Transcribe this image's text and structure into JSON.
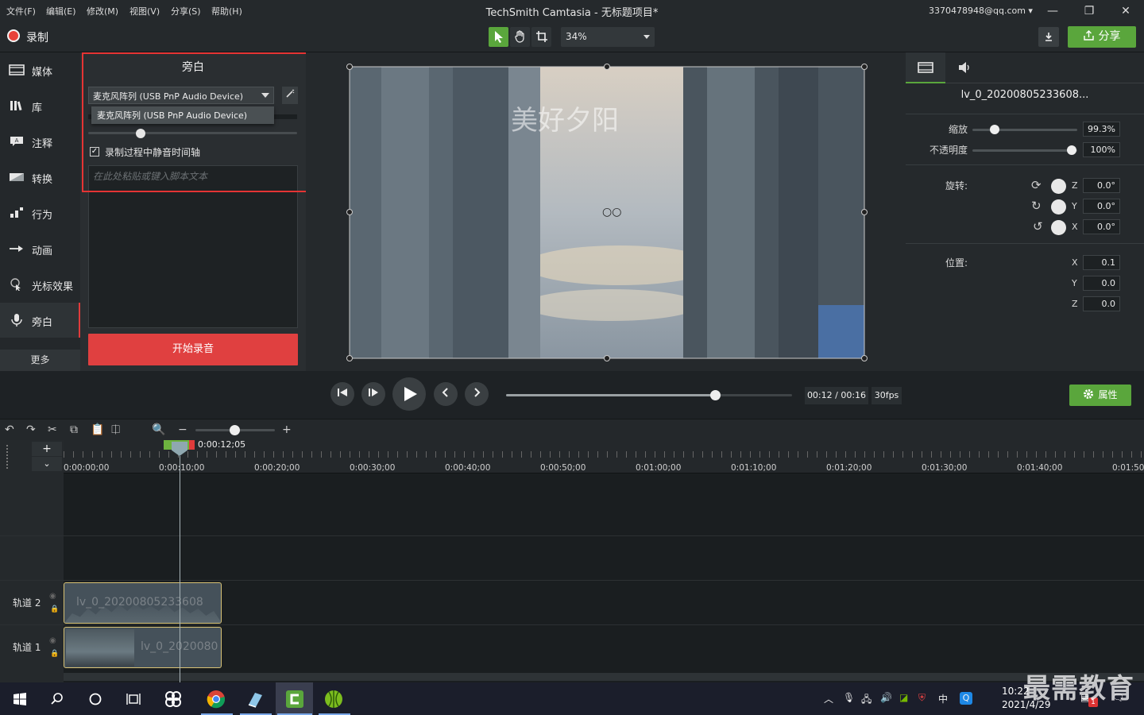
{
  "menu": [
    "文件(F)",
    "编辑(E)",
    "修改(M)",
    "视图(V)",
    "分享(S)",
    "帮助(H)"
  ],
  "app_title": "TechSmith Camtasia - 无标题项目*",
  "account": "3370478948@qq.com ▾",
  "window_controls": {
    "minimize": "—",
    "restore": "❐",
    "close": "✕"
  },
  "toolbar": {
    "record_label": "录制",
    "zoom": "34%",
    "share_label": "分享"
  },
  "sidebar": {
    "items": [
      {
        "label": "媒体",
        "icon": "film-icon"
      },
      {
        "label": "库",
        "icon": "library-icon"
      },
      {
        "label": "注释",
        "icon": "annotation-icon"
      },
      {
        "label": "转换",
        "icon": "transition-icon"
      },
      {
        "label": "行为",
        "icon": "behavior-icon"
      },
      {
        "label": "动画",
        "icon": "animation-icon"
      },
      {
        "label": "光标效果",
        "icon": "cursor-icon"
      },
      {
        "label": "旁白",
        "icon": "microphone-icon"
      }
    ],
    "more_label": "更多"
  },
  "voice_panel": {
    "title": "旁白",
    "mic_selected": "麦克风阵列 (USB PnP Audio Device)",
    "mic_option": "麦克风阵列 (USB PnP Audio Device)",
    "volume_level": 0.25,
    "mute_label": "录制过程中静音时间轴",
    "mute_checked": "✓",
    "script_placeholder": "在此处粘贴或键入脚本文本",
    "start_label": "开始录音"
  },
  "canvas": {
    "caption": "美好夕阳",
    "center_mark": "○○"
  },
  "properties": {
    "clip_name": "lv_0_20200805233608...",
    "scale_label": "缩放",
    "scale_value": "99.3%",
    "opacity_label": "不透明度",
    "opacity_value": "100%",
    "rotation_label": "旋转:",
    "rot_z": "0.0°",
    "rot_y": "0.0°",
    "rot_x": "0.0°",
    "position_label": "位置:",
    "pos_x": "0.1",
    "pos_y": "0.0",
    "pos_z": "0.0",
    "axis_z": "Z",
    "axis_y": "Y",
    "axis_x": "X"
  },
  "playback": {
    "timecode": "00:12 / 00:16",
    "fps": "30fps",
    "progress": 0.73,
    "properties_label": "属性"
  },
  "timeline": {
    "playhead_time": "0:00:12;05",
    "ticks": [
      "0:00:00;00",
      "0:00:10;00",
      "0:00:20;00",
      "0:00:30;00",
      "0:00:40;00",
      "0:00:50;00",
      "0:01:00;00",
      "0:01:10;00",
      "0:01:20;00",
      "0:01:30;00",
      "0:01:40;00",
      "0:01:50;00"
    ],
    "tracks": [
      {
        "name": "轨道 2",
        "clip": "lv_0_20200805233608"
      },
      {
        "name": "轨道 1",
        "clip": "lv_0_2020080"
      }
    ]
  },
  "taskbar": {
    "time": "10:22",
    "date": "2021/4/29",
    "ime": "中",
    "notification_count": "1"
  },
  "watermark": "最需教育"
}
